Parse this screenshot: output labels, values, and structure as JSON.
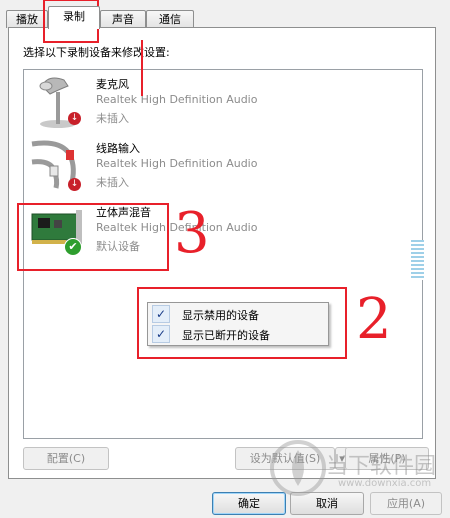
{
  "tabs": [
    {
      "label": "播放"
    },
    {
      "label": "录制"
    },
    {
      "label": "声音"
    },
    {
      "label": "通信"
    }
  ],
  "instruction": "选择以下录制设备来修改设置:",
  "devices": [
    {
      "name": "麦克风",
      "driver": "Realtek High Definition Audio",
      "status": "未插入"
    },
    {
      "name": "线路输入",
      "driver": "Realtek High Definition Audio",
      "status": "未插入"
    },
    {
      "name": "立体声混音",
      "driver": "Realtek High Definition Audio",
      "status": "默认设备"
    }
  ],
  "context_menu": [
    {
      "label": "显示禁用的设备",
      "checked": true
    },
    {
      "label": "显示已断开的设备",
      "checked": true
    }
  ],
  "buttons": {
    "configure": "配置(C)",
    "set_default": "设为默认值(S)",
    "properties": "属性(P)",
    "ok": "确定",
    "cancel": "取消",
    "apply": "应用(A)"
  },
  "annotations": {
    "label_2": "2",
    "label_3": "3",
    "color": "#e8202a"
  },
  "watermark": {
    "text": "当下软件园",
    "url": "www.downxia.com"
  },
  "colors": {
    "annotation": "#e8202a",
    "ok_badge": "#2e9e2e",
    "unplugged_badge": "#c8202a"
  }
}
